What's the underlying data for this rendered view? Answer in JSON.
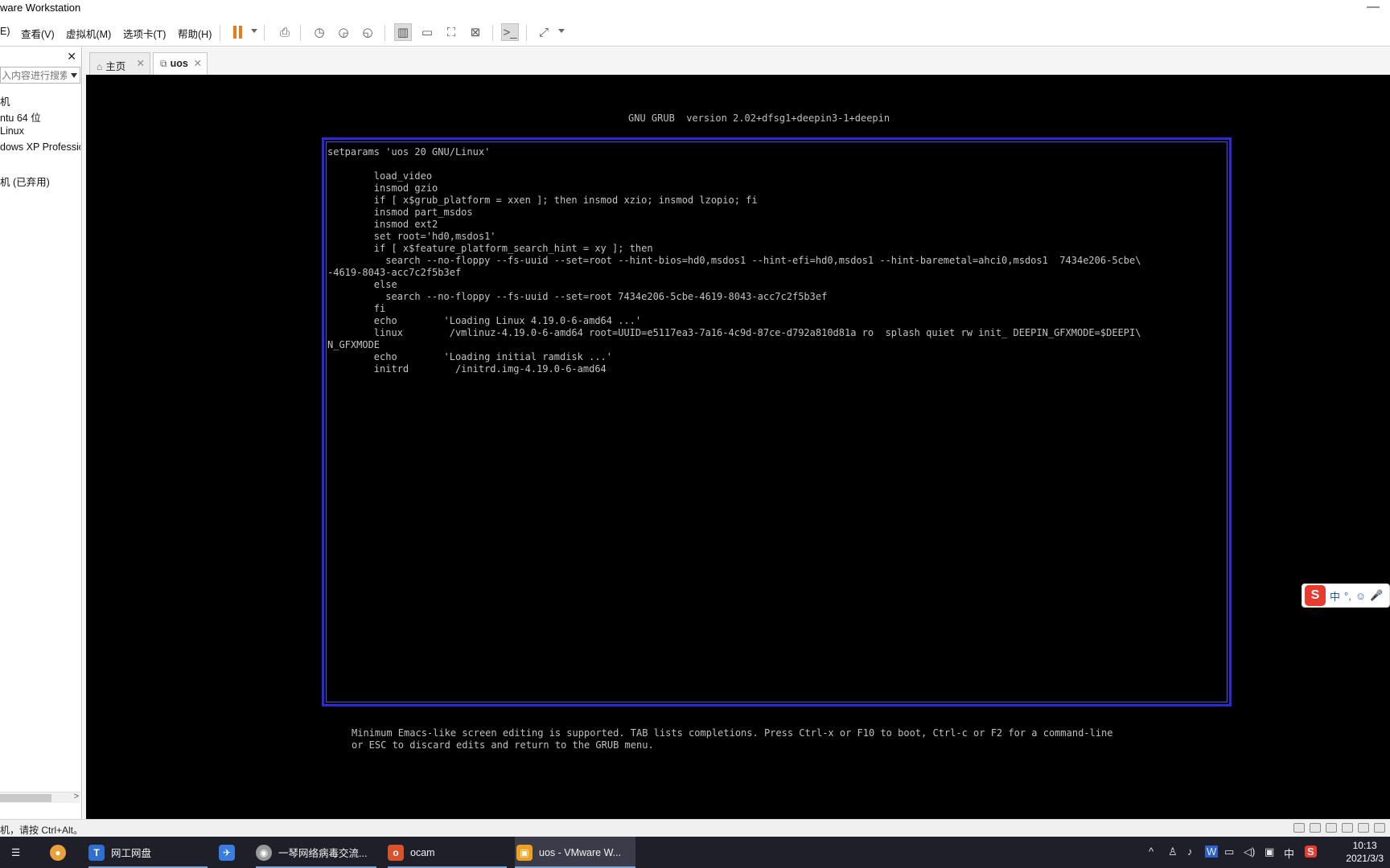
{
  "window": {
    "title": "ware Workstation",
    "minimize_glyph": "—"
  },
  "menu": [
    "E)",
    "查看(V)",
    "虚拟机(M)",
    "选项卡(T)",
    "帮助(H)"
  ],
  "sidebar": {
    "search_placeholder": "入内容进行搜索",
    "items": [
      "机",
      "ntu 64 位",
      "Linux",
      "dows XP Professic",
      "",
      "机 (已弃用)"
    ]
  },
  "tabs": [
    {
      "label": "主页",
      "icon": "home-icon"
    },
    {
      "label": "uos",
      "icon": "vm-icon",
      "active": true
    }
  ],
  "grub": {
    "header": "GNU GRUB  version 2.02+dfsg1+deepin3-1+deepin",
    "lines": [
      "setparams 'uos 20 GNU/Linux'",
      "",
      "        load_video",
      "        insmod gzio",
      "        if [ x$grub_platform = xxen ]; then insmod xzio; insmod lzopio; fi",
      "        insmod part_msdos",
      "        insmod ext2",
      "        set root='hd0,msdos1'",
      "        if [ x$feature_platform_search_hint = xy ]; then",
      "          search --no-floppy --fs-uuid --set=root --hint-bios=hd0,msdos1 --hint-efi=hd0,msdos1 --hint-baremetal=ahci0,msdos1  7434e206-5cbe\\",
      "-4619-8043-acc7c2f5b3ef",
      "        else",
      "          search --no-floppy --fs-uuid --set=root 7434e206-5cbe-4619-8043-acc7c2f5b3ef",
      "        fi",
      "        echo        'Loading Linux 4.19.0-6-amd64 ...'",
      "        linux        /vmlinuz-4.19.0-6-amd64 root=UUID=e5117ea3-7a16-4c9d-87ce-d792a810d81a ro  splash quiet rw init_ DEEPIN_GFXMODE=$DEEPI\\",
      "N_GFXMODE",
      "        echo        'Loading initial ramdisk ...'",
      "        initrd        /initrd.img-4.19.0-6-amd64"
    ],
    "help": [
      "Minimum Emacs-like screen editing is supported. TAB lists completions. Press Ctrl-x or F10 to boot, Ctrl-c or F2 for a command-line",
      "or ESC to discard edits and return to the GRUB menu."
    ]
  },
  "ime": {
    "logo": "S",
    "mode": "中",
    "punct": "°,",
    "emoji": "☺",
    "mic": "🎤"
  },
  "statusbar": {
    "message": "机，请按 Ctrl+Alt。"
  },
  "taskbar": {
    "items": [
      {
        "label": "网工网盘",
        "color": "#2e6fd0",
        "glyph": "T"
      },
      {
        "label": "",
        "color": "#3a7de0",
        "glyph": "✈"
      },
      {
        "label": "一琴网络病毒交流...",
        "color": "#999999",
        "glyph": "◉"
      },
      {
        "label": "ocam",
        "color": "#d9522c",
        "glyph": "o"
      },
      {
        "label": "uos - VMware W...",
        "color": "#f0a020",
        "glyph": "▣"
      }
    ],
    "tray": {
      "input_lang": "中",
      "ime_logo": "S"
    },
    "clock": {
      "time": "10:13",
      "date": "2021/3/3"
    }
  },
  "colors": {
    "grub_border": "#2a2ad8",
    "console_bg": "#000000",
    "pause": "#e87a1d",
    "taskbar": "#1f1f2a"
  }
}
